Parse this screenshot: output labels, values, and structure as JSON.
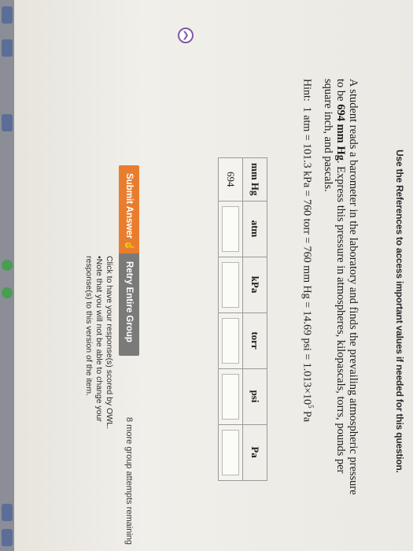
{
  "header": {
    "references_text": "Use the References to access important values if needed for this question."
  },
  "question": {
    "text_before": "A student reads a barometer in the laboratory and finds the prevailing atmospheric pressure to be ",
    "value_bold": "694",
    "unit_bold": " mm Hg",
    "text_after": ". Express this pressure in atmospheres, kilopascals, torrs, pounds per square inch, and pascals."
  },
  "hint": {
    "label": "Hint:",
    "body": "1 atm  =  101.3 kPa  =  760 torr  =  760 mm Hg  =  14.69 psi  =  1.013×10",
    "exp": "5",
    "tail": " Pa"
  },
  "table": {
    "headers": [
      "mm Hg",
      "atm",
      "kPa",
      "torr",
      "psi",
      "Pa"
    ],
    "given_value": "694"
  },
  "actions": {
    "submit_label": "Submit Answer",
    "retry_label": "Retry Entire Group",
    "attempts_text": "8 more group attempts remaining"
  },
  "notes": {
    "line1": "Click to have your response(s) scored by OWL.",
    "line2": "•Note that you will not be able to change your",
    "line3": "response(s) to this version of the item."
  },
  "colors": {
    "submit": "#e97d2e",
    "retry": "#7a7a78",
    "nav_accent": "#7d5aa6"
  },
  "icons": {
    "nav": "chevron-up-icon",
    "cursor": "hand-cursor-icon"
  }
}
